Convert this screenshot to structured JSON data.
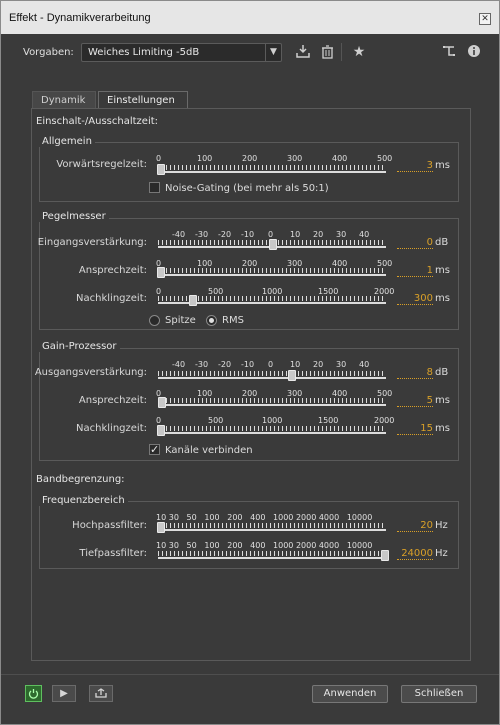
{
  "window": {
    "title": "Effekt - Dynamikverarbeitung",
    "close": "✕"
  },
  "toolbar": {
    "preset_label": "Vorgaben:",
    "preset_value": "Weiches Limiting -5dB",
    "icons": [
      "save-preset-icon",
      "delete-preset-icon",
      "favorite-icon",
      "routing-icon",
      "info-icon"
    ]
  },
  "tabs": [
    {
      "label": "Dynamik"
    },
    {
      "label": "Einstellungen"
    }
  ],
  "einstellungen": {
    "title": "Einschalt-/Ausschaltzeit:",
    "allgemein": {
      "title": "Allgemein",
      "vorwaerts": {
        "label": "Vorwärtsregelzeit:",
        "scale": [
          "0",
          "100",
          "200",
          "300",
          "400",
          "500"
        ],
        "value": "3",
        "unit": "ms",
        "fraction": 0.006
      },
      "noise_gating": {
        "label": "Noise-Gating (bei mehr als 50:1)",
        "checked": false
      }
    },
    "pegelmesser": {
      "title": "Pegelmesser",
      "eingang": {
        "label": "Eingangsverstärkung:",
        "scale": [
          "-40",
          "-30",
          "-20",
          "-10",
          "0",
          "10",
          "20",
          "30",
          "40"
        ],
        "value": "0",
        "unit": "dB"
      },
      "ansprech": {
        "label": "Ansprechzeit:",
        "scale": [
          "0",
          "100",
          "200",
          "300",
          "400",
          "500"
        ],
        "value": "1",
        "unit": "ms"
      },
      "nachkling": {
        "label": "Nachklingzeit:",
        "scale": [
          "0",
          "500",
          "1000",
          "1500",
          "2000"
        ],
        "value": "300",
        "unit": "ms"
      },
      "mode": {
        "spitze": "Spitze",
        "rms": "RMS",
        "selected": "RMS"
      }
    },
    "gain": {
      "title": "Gain-Prozessor",
      "ausgang": {
        "label": "Ausgangsverstärkung:",
        "scale": [
          "-40",
          "-30",
          "-20",
          "-10",
          "0",
          "10",
          "20",
          "30",
          "40"
        ],
        "value": "8",
        "unit": "dB"
      },
      "ansprech": {
        "label": "Ansprechzeit:",
        "scale": [
          "0",
          "100",
          "200",
          "300",
          "400",
          "500"
        ],
        "value": "5",
        "unit": "ms"
      },
      "nachkling": {
        "label": "Nachklingzeit:",
        "scale": [
          "0",
          "500",
          "1000",
          "1500",
          "2000"
        ],
        "value": "15",
        "unit": "ms"
      },
      "kanaele": {
        "label": "Kanäle verbinden",
        "checked": true
      }
    },
    "band": {
      "title": "Bandbegrenzung:",
      "frequenz": {
        "title": "Frequenzbereich",
        "freq_scale": "10 30   50   100   200   400   1000 2000 4000   10000",
        "hoch": {
          "label": "Hochpassfilter:",
          "value": "20",
          "unit": "Hz"
        },
        "tief": {
          "label": "Tiefpassfilter:",
          "value": "24000",
          "unit": "Hz"
        }
      }
    }
  },
  "footer": {
    "apply": "Anwenden",
    "close": "Schließen",
    "play": "▶",
    "loop": "⮌"
  }
}
